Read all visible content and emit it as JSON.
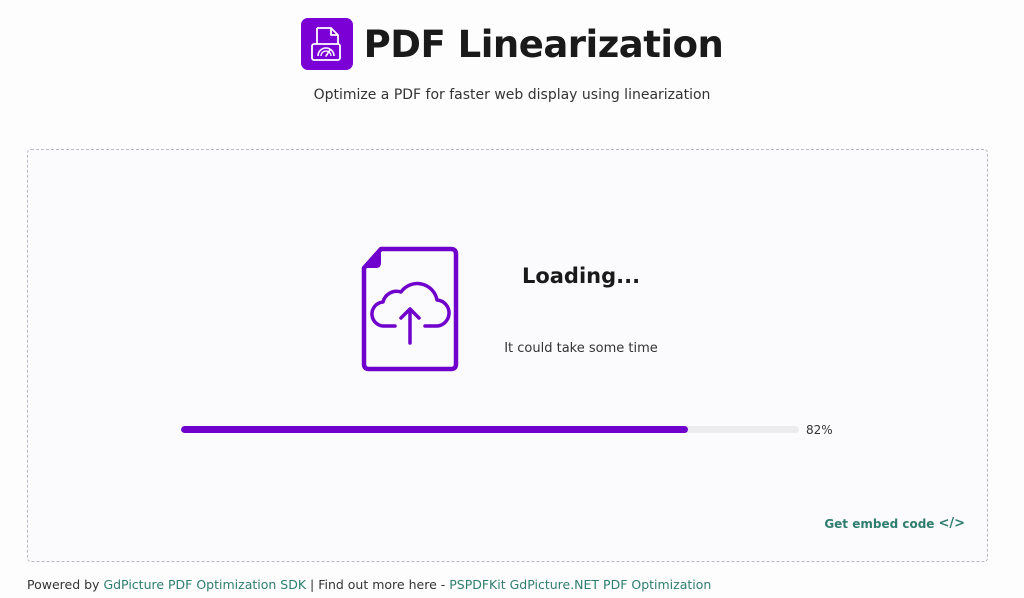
{
  "header": {
    "title": "PDF Linearization",
    "subtitle": "Optimize a PDF for faster web display using linearization",
    "logo_icon": "pdf-speedometer-icon"
  },
  "colors": {
    "accent": "#7000cc",
    "link": "#2e7d6e",
    "track": "#ececef"
  },
  "status": {
    "title": "Loading...",
    "subtitle": "It could take some time",
    "icon": "file-upload-cloud-icon"
  },
  "progress": {
    "value": 0.82,
    "label": "82%"
  },
  "embed": {
    "label": "Get embed code",
    "icon_glyph": "</>"
  },
  "footer": {
    "prefix": "Powered by ",
    "link1": "GdPicture PDF Optimization SDK",
    "middle": " | Find out more here - ",
    "link2": "PSPDFKit GdPicture.NET PDF Optimization"
  }
}
